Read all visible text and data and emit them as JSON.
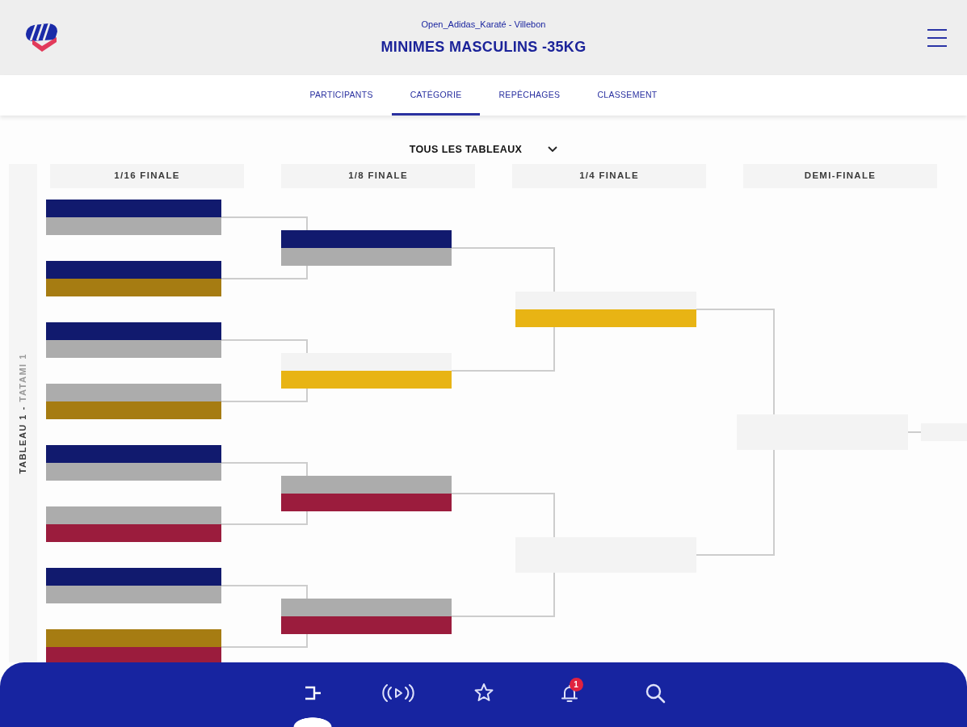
{
  "header": {
    "event": "Open_Adidas_Karaté - Villebon",
    "title": "MINIMES MASCULINS -35KG"
  },
  "tabs": [
    {
      "label": "PARTICIPANTS",
      "selected": false
    },
    {
      "label": "CATÉGORIE",
      "selected": true
    },
    {
      "label": "REPÊCHAGES",
      "selected": false
    },
    {
      "label": "CLASSEMENT",
      "selected": false
    }
  ],
  "table_select": {
    "value": "TOUS LES TABLEAUX"
  },
  "side_label": {
    "table": "TABLEAU 1 -",
    "tatami": "TATAMI 1"
  },
  "rounds": [
    {
      "title": "1/16 FINALE",
      "matches": [
        {
          "slots": [
            {
              "color": "#111a6e"
            },
            {
              "color": "#acacac"
            }
          ]
        },
        {
          "slots": [
            {
              "color": "#111a6e"
            },
            {
              "color": "#a67c12"
            }
          ]
        },
        {
          "slots": [
            {
              "color": "#111a6e"
            },
            {
              "color": "#acacac"
            }
          ]
        },
        {
          "slots": [
            {
              "color": "#acacac"
            },
            {
              "color": "#a67c12"
            }
          ]
        },
        {
          "slots": [
            {
              "color": "#111a6e"
            },
            {
              "color": "#acacac"
            }
          ]
        },
        {
          "slots": [
            {
              "color": "#acacac"
            },
            {
              "color": "#9b1c3d"
            }
          ]
        },
        {
          "slots": [
            {
              "color": "#111a6e"
            },
            {
              "color": "#acacac"
            }
          ]
        },
        {
          "slots": [
            {
              "color": "#a67c12"
            },
            {
              "color": "#9b1c3d"
            }
          ]
        }
      ]
    },
    {
      "title": "1/8 FINALE",
      "matches": [
        {
          "slots": [
            {
              "color": "#111a6e"
            },
            {
              "color": "#acacac"
            }
          ]
        },
        {
          "slots": [
            {
              "color": "#f3f3f3"
            },
            {
              "color": "#e8b414"
            }
          ]
        },
        {
          "slots": [
            {
              "color": "#acacac"
            },
            {
              "color": "#9b1c3d"
            }
          ]
        },
        {
          "slots": [
            {
              "color": "#acacac"
            },
            {
              "color": "#9b1c3d"
            }
          ]
        }
      ]
    },
    {
      "title": "1/4 FINALE",
      "matches": [
        {
          "slots": [
            {
              "color": "#f3f3f3"
            },
            {
              "color": "#e8b414"
            }
          ]
        },
        {
          "slots": [
            {
              "color": "#f3f3f3"
            },
            {
              "color": "#f3f3f3"
            }
          ]
        }
      ]
    },
    {
      "title": "DEMI-FINALE",
      "matches": [
        {
          "slots": [
            {
              "color": "#f3f3f3"
            },
            {
              "color": "#f3f3f3"
            }
          ]
        }
      ]
    },
    {
      "matches": [
        {
          "slots": [
            {
              "color": "#f3f3f3"
            }
          ]
        }
      ]
    }
  ],
  "bottom_nav": [
    {
      "kind": "bracket",
      "selected": true
    },
    {
      "kind": "live",
      "selected": false
    },
    {
      "kind": "favorites",
      "selected": false
    },
    {
      "kind": "notifications",
      "selected": false,
      "badge": "1"
    },
    {
      "kind": "search",
      "selected": false
    }
  ]
}
